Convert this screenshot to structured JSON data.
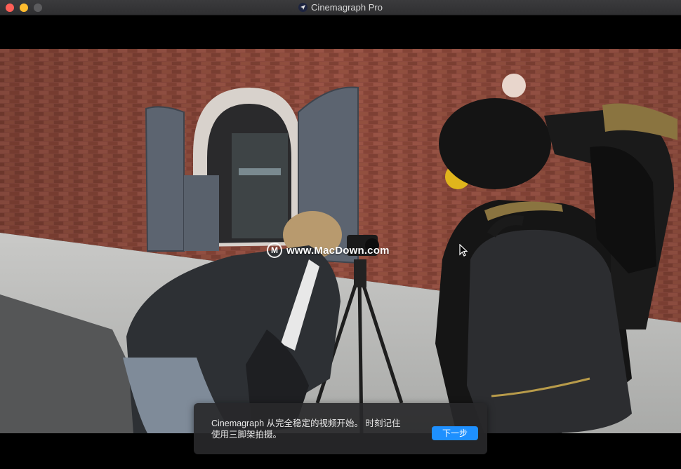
{
  "window": {
    "title": "Cinemagraph Pro",
    "app_icon": "cinemagraph-app-icon"
  },
  "watermark": {
    "logo_letter": "M",
    "text": "www.MacDown.com"
  },
  "onboarding": {
    "message_line1": "Cinemagraph 从完全稳定的视频开始。 时刻记住",
    "message_line2": "使用三脚架拍摄。",
    "next_button": "下一步"
  },
  "colors": {
    "accent": "#1e90ff",
    "close": "#fe5f57",
    "minimize": "#febc2e"
  }
}
